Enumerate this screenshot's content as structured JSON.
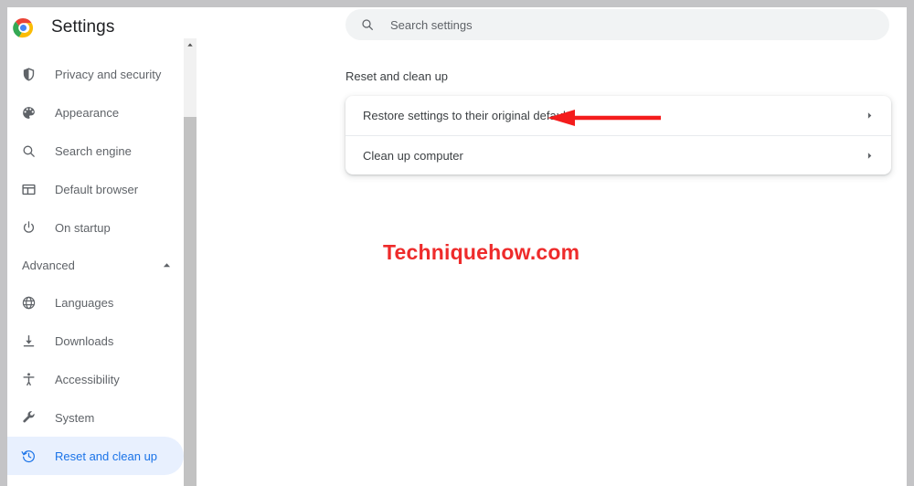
{
  "window": {
    "frame_color": "#c4c4c6",
    "surface_color": "#ffffff"
  },
  "sidebar": {
    "brand": {
      "logo_icon": "chrome-logo-icon",
      "title": "Settings"
    },
    "items": [
      {
        "label": "Privacy and security",
        "icon": "shield-icon",
        "active": false
      },
      {
        "label": "Appearance",
        "icon": "palette-icon",
        "active": false
      },
      {
        "label": "Search engine",
        "icon": "search-icon",
        "active": false
      },
      {
        "label": "Default browser",
        "icon": "browser-window-icon",
        "active": false
      },
      {
        "label": "On startup",
        "icon": "power-icon",
        "active": false
      }
    ],
    "section": {
      "label": "Advanced",
      "caret_icon": "chevron-up-icon",
      "expanded": true
    },
    "advanced_items": [
      {
        "label": "Languages",
        "icon": "globe-icon",
        "active": false
      },
      {
        "label": "Downloads",
        "icon": "download-icon",
        "active": false
      },
      {
        "label": "Accessibility",
        "icon": "accessibility-icon",
        "active": false
      },
      {
        "label": "System",
        "icon": "wrench-icon",
        "active": false
      },
      {
        "label": "Reset and clean up",
        "icon": "restore-clock-icon",
        "active": true
      }
    ],
    "active_color": "#1a73e8",
    "active_background": "#e8f0fe",
    "text_color": "#5f6368"
  },
  "scrollbar": {
    "up_arrow_icon": "scroll-up-arrow-icon",
    "track_color": "#f1f1f1",
    "thumb_color": "#c2c2c2"
  },
  "search": {
    "icon": "search-icon",
    "placeholder": "Search settings",
    "value": ""
  },
  "main": {
    "section_title": "Reset and clean up",
    "rows": [
      {
        "label": "Restore settings to their original defaults",
        "chevron_icon": "chevron-right-icon"
      },
      {
        "label": "Clean up computer",
        "chevron_icon": "chevron-right-icon"
      }
    ]
  },
  "annotation": {
    "arrow_icon": "red-left-arrow-icon",
    "arrow_color": "#f41c1c",
    "points_to": "Restore settings to their original defaults"
  },
  "watermark": {
    "text": "Techniquehow.com",
    "color": "#ee2b2b"
  }
}
